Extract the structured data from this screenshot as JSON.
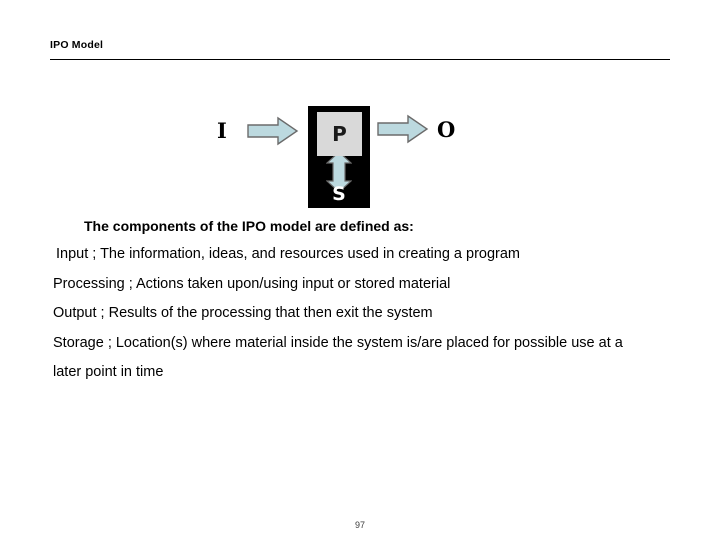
{
  "slide": {
    "title": "IPO Model",
    "page_number": "97"
  },
  "diagram": {
    "name": "ipo-model-diagram",
    "input_letter": "I",
    "output_letter": "O",
    "processing_letter": "P",
    "storage_letter": "S",
    "arrow_fill_color": "#bcd9df",
    "arrow_stroke_color": "#6b6b6b",
    "system_box_color": "#000000",
    "processing_box_color": "#d9d9d9",
    "storage_text_color": "#ffffff"
  },
  "body": {
    "intro_prefix": "The components of the ",
    "intro_emphasis": "IPO",
    "intro_suffix": " model are defined as:",
    "lines": [
      "Input ; The information, ideas, and resources used in creating a program",
      "Processing ; Actions taken upon/using input or stored material",
      "Output ; Results of the processing that then exit the system",
      "Storage ; Location(s) where material inside the system is/are placed for possible use at a later point in time"
    ]
  }
}
